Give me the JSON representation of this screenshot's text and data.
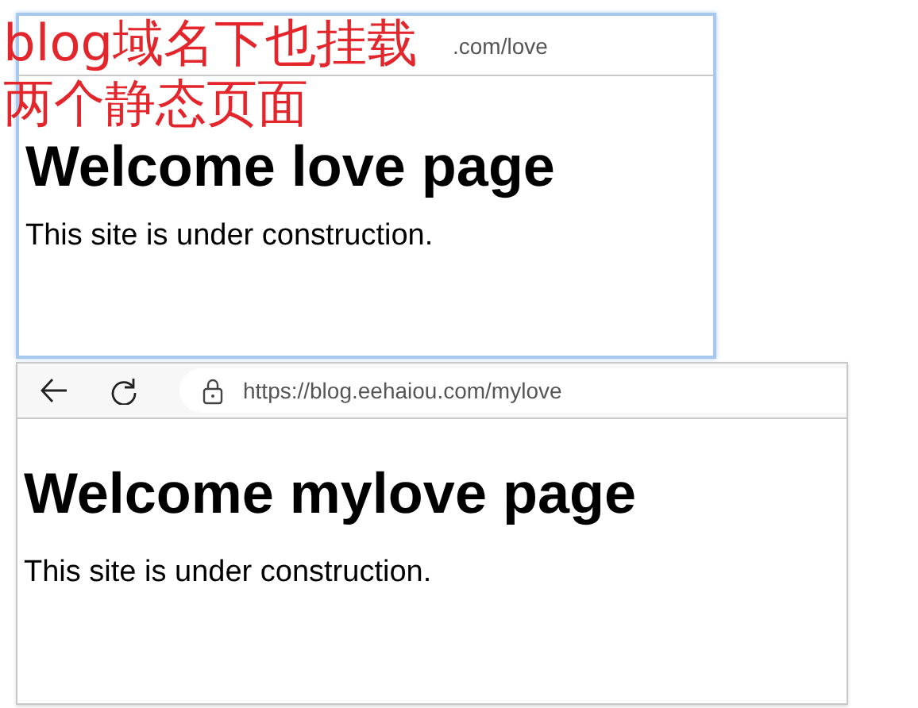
{
  "annotation": {
    "lines": [
      "blog域名下也挂载",
      "两个静态页面"
    ]
  },
  "windows": [
    {
      "kind": "covered",
      "active": true,
      "url": ".com/love",
      "heading": "Welcome love page",
      "text": "This site is under construction."
    },
    {
      "kind": "full",
      "active": false,
      "url": "https://blog.eehaiou.com/mylove",
      "heading": "Welcome mylove page",
      "text": "This site is under construction."
    }
  ]
}
